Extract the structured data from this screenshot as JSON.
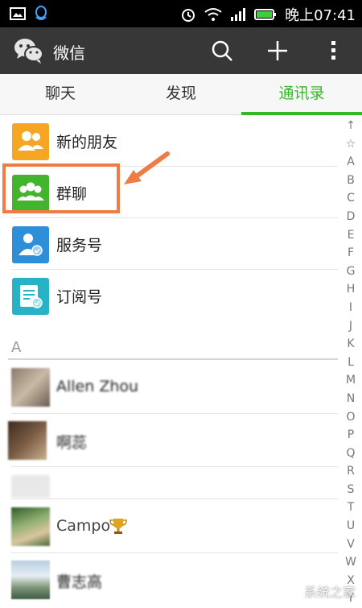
{
  "status_bar": {
    "time": "晚上07:41"
  },
  "app_bar": {
    "title": "微信"
  },
  "tabs": [
    {
      "label": "聊天"
    },
    {
      "label": "发现"
    },
    {
      "label": "通讯录"
    }
  ],
  "menu_items": [
    {
      "label": "新的朋友",
      "icon": "user-add-icon",
      "color": "#f6a623"
    },
    {
      "label": "群聊",
      "icon": "group-chat-icon",
      "color": "#43b52d"
    },
    {
      "label": "服务号",
      "icon": "service-account-icon",
      "color": "#2f8ed8"
    },
    {
      "label": "订阅号",
      "icon": "subscription-icon",
      "color": "#27b2c6"
    }
  ],
  "section_letter": "A",
  "contacts": [
    {
      "name": "Allen Zhou"
    },
    {
      "name": "啊蕊"
    },
    {
      "name": "Campo"
    },
    {
      "name": "曹志高"
    }
  ],
  "index_letters": [
    "↑",
    "☆",
    "A",
    "B",
    "C",
    "D",
    "E",
    "F",
    "G",
    "H",
    "I",
    "J",
    "K",
    "L",
    "M",
    "N",
    "O",
    "P",
    "Q",
    "R",
    "S",
    "T",
    "U",
    "V",
    "W",
    "X",
    "Y"
  ],
  "watermark": "系统之家",
  "colors": {
    "accent": "#35b729",
    "highlight": "#ef7b45"
  }
}
